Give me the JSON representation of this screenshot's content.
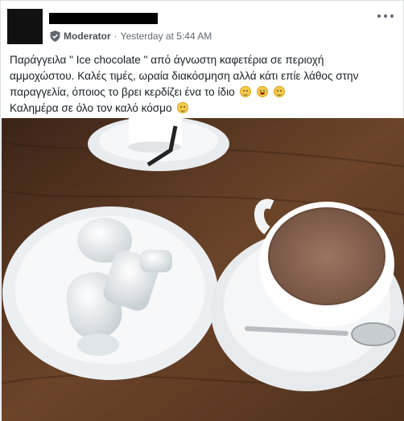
{
  "post": {
    "author_role": "Moderator",
    "timestamp": "Yesterday at 5:44 AM",
    "lines": [
      "Παράγγειλα \" Ice chocolate \" από άγνωστη καφετέρια σε περιοχή",
      "αμμοχώστου. Καλές τιμές, ωραία διακόσμηση αλλά κάτι επίε λάθος στην",
      "παραγγελία, όποιος το βρει κερδίζει ένα το ίδιο",
      "Καλημέρα σε όλο τον καλό κόσμο"
    ],
    "emoji_line3": [
      "grinning-face",
      "grinning-face-big-eyes",
      "smiling-face"
    ],
    "emoji_line4": [
      "winking-face"
    ]
  },
  "colors": {
    "text": "#1c1e21",
    "meta": "#606770",
    "table": "#5a3a24",
    "cocoa": "#8a6552"
  },
  "icons": {
    "shield": "shield-icon",
    "more": "more-options-icon"
  }
}
